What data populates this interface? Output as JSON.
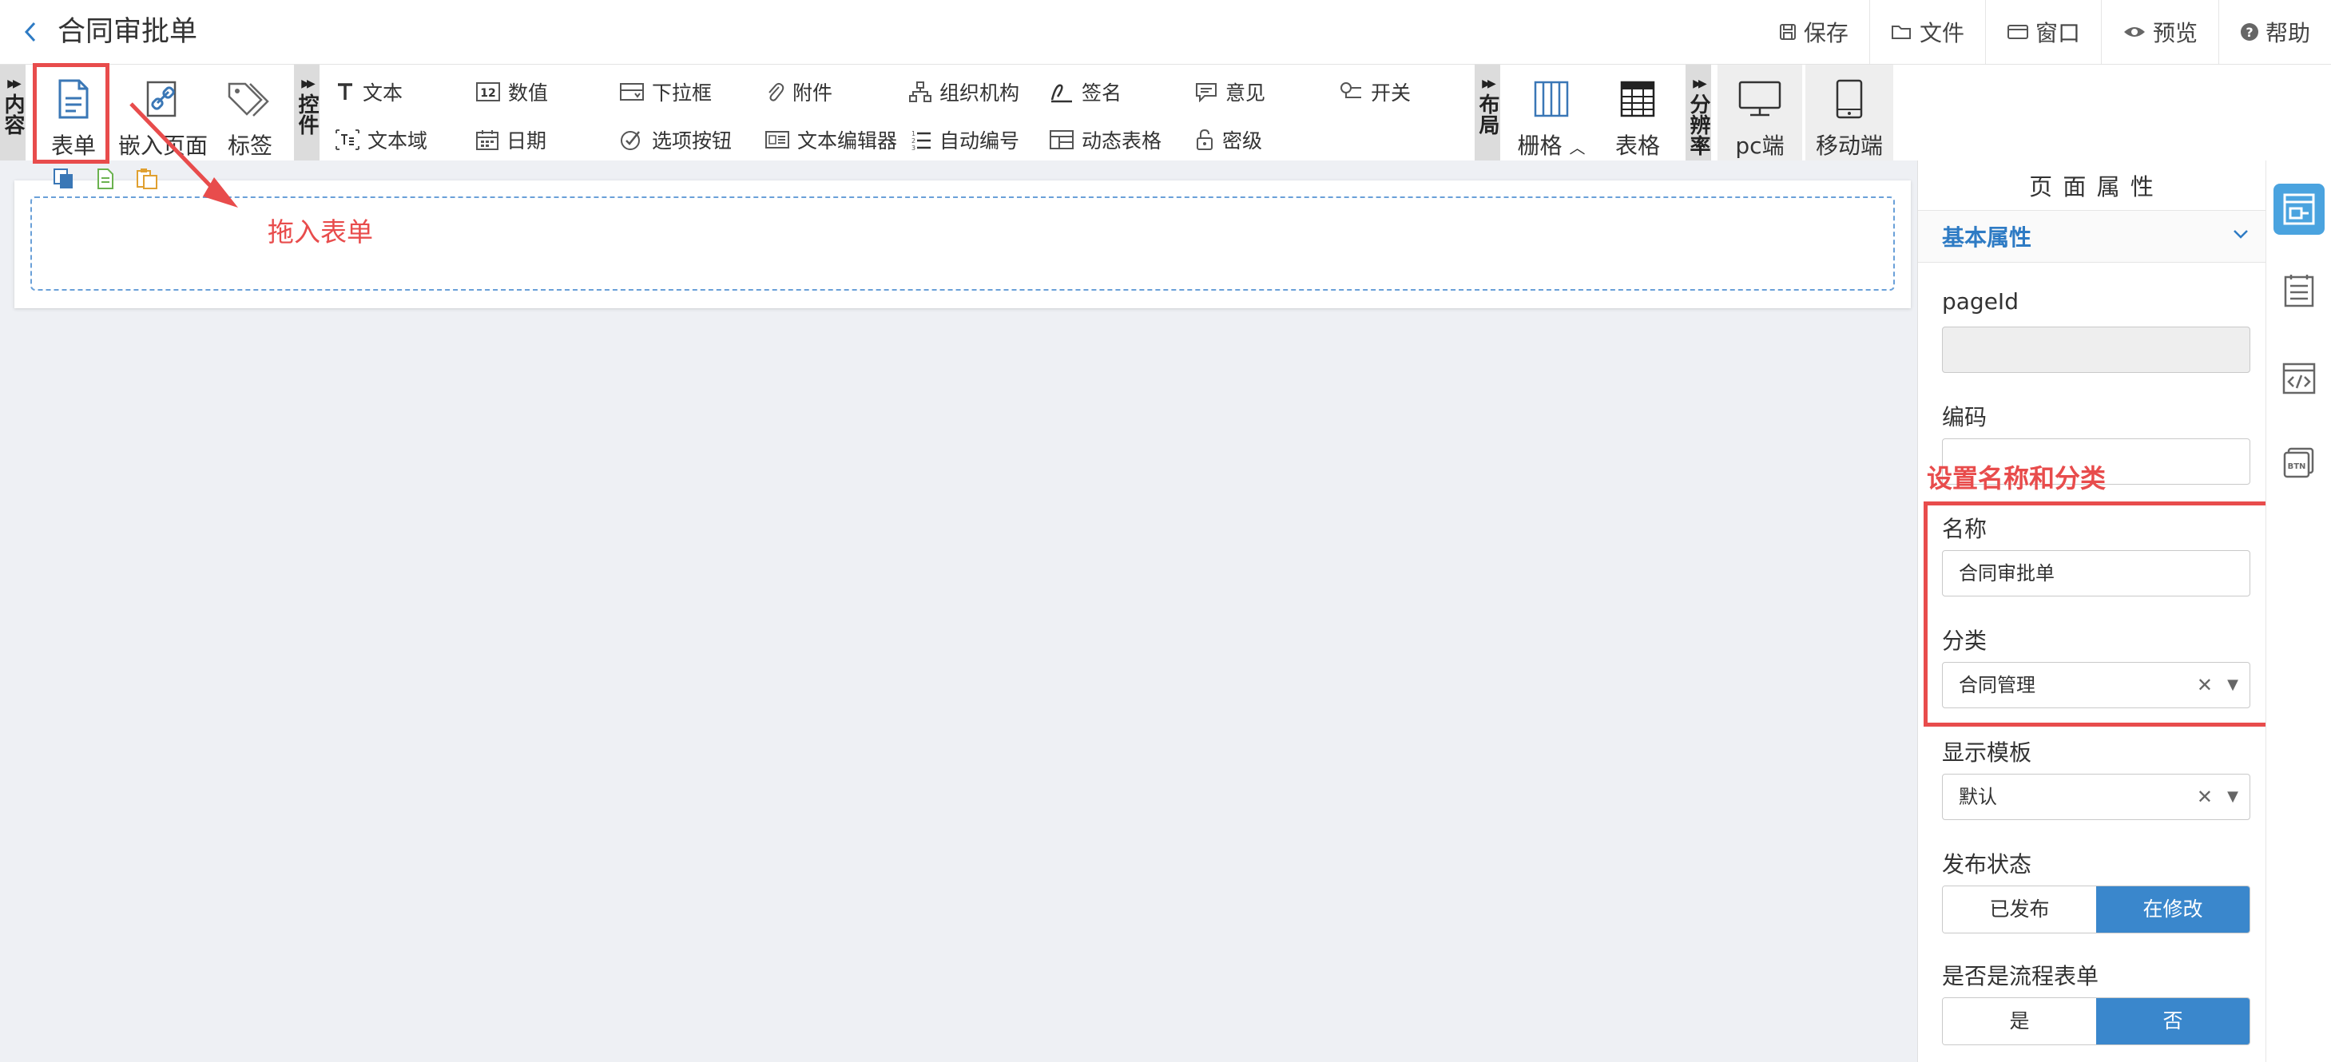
{
  "header": {
    "title": "合同审批单",
    "buttons": [
      {
        "icon": "save-icon",
        "label": "保存"
      },
      {
        "icon": "folder-icon",
        "label": "文件"
      },
      {
        "icon": "window-icon",
        "label": "窗口"
      },
      {
        "icon": "eye-icon",
        "label": "预览"
      },
      {
        "icon": "help-icon",
        "label": "帮助"
      }
    ]
  },
  "toolbar": {
    "content_tab": "内容",
    "controls_tab": "控件",
    "layout_tab": "布局",
    "resolution_tab": "分辨率",
    "content_items": [
      {
        "icon": "form-doc-icon",
        "label": "表单"
      },
      {
        "icon": "link-icon",
        "label": "嵌入页面"
      },
      {
        "icon": "tag-icon",
        "label": "标签"
      }
    ],
    "controls_row1": [
      {
        "icon": "text-icon",
        "label": "文本"
      },
      {
        "icon": "number-icon",
        "label": "数值"
      },
      {
        "icon": "dropdown-icon",
        "label": "下拉框"
      },
      {
        "icon": "paperclip-icon",
        "label": "附件"
      },
      {
        "icon": "org-chart-icon",
        "label": "组织机构"
      },
      {
        "icon": "signature-icon",
        "label": "签名"
      },
      {
        "icon": "comment-icon",
        "label": "意见"
      },
      {
        "icon": "toggle-icon",
        "label": "开关"
      }
    ],
    "controls_row2": [
      {
        "icon": "textarea-icon",
        "label": "文本域"
      },
      {
        "icon": "calendar-icon",
        "label": "日期"
      },
      {
        "icon": "option-button-icon",
        "label": "选项按钮"
      },
      {
        "icon": "text-editor-icon",
        "label": "文本编辑器"
      },
      {
        "icon": "auto-number-icon",
        "label": "自动编号"
      },
      {
        "icon": "dynamic-table-icon",
        "label": "动态表格"
      },
      {
        "icon": "lock-icon",
        "label": "密级"
      }
    ],
    "layout_items": [
      {
        "icon": "grid-columns-icon",
        "label": "栅格"
      },
      {
        "icon": "table-icon",
        "label": "表格"
      }
    ],
    "resolution_items": [
      {
        "icon": "monitor-icon",
        "label": "pc端"
      },
      {
        "icon": "tablet-icon",
        "label": "移动端"
      }
    ]
  },
  "annotations": {
    "drag_hint": "拖入表单",
    "set_hint": "设置名称和分类"
  },
  "panel": {
    "title": "页 面 属 性",
    "section": "基本属性",
    "fields": {
      "page_id_label": "pageId",
      "page_id_value": "",
      "code_label": "编码",
      "code_value": "",
      "name_label": "名称",
      "name_value": "合同审批单",
      "category_label": "分类",
      "category_value": "合同管理",
      "template_label": "显示模板",
      "template_value": "默认",
      "publish_label": "发布状态",
      "publish_options": [
        "已发布",
        "在修改"
      ],
      "publish_selected": "在修改",
      "flow_label": "是否是流程表单",
      "flow_options": [
        "是",
        "否"
      ],
      "flow_selected": "否"
    }
  },
  "rail": [
    "page-properties-icon",
    "list-icon",
    "code-icon",
    "button-icon"
  ],
  "colors": {
    "accent": "#3a87cc",
    "annotation": "#e84c4c",
    "link_blue": "#2e7bc4"
  }
}
